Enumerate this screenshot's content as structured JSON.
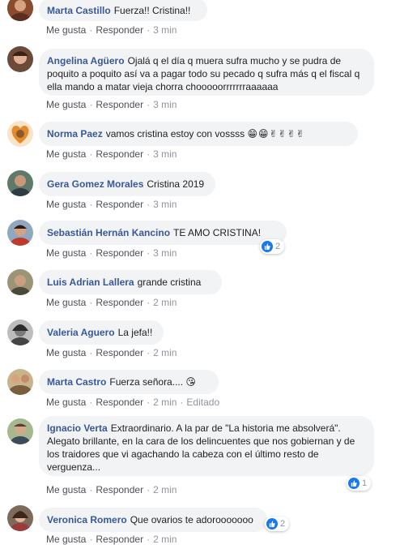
{
  "actions": {
    "like": "Me gusta",
    "reply": "Responder",
    "separator": "·"
  },
  "comments": [
    {
      "author": "Marta Castillo",
      "text": "Fuerza!! Cristina!!",
      "time": "3 min"
    },
    {
      "author": "Angelina Agüero",
      "text": "Ojalá q el día q muera sufra mucho y se pudra de poquito a poquito así va a pagar todo su pecado q sufra más q el fiscal q ella mando a matar vieja chorra chooooorrrrrrraaaaaa",
      "time": "3 min"
    },
    {
      "author": "Norma Paez",
      "text": "vamos cristina estoy con vossss",
      "emoji": "😁😁✌✌✌✌",
      "time": "3 min"
    },
    {
      "author": "Gera Gomez Morales",
      "text": "Cristina 2019",
      "time": "3 min"
    },
    {
      "author": "Sebastián Hernán Kancino",
      "text": "TE AMO CRISTINA!",
      "time": "3 min",
      "likes": "2"
    },
    {
      "author": "Luis Adrian Lallera",
      "text": "grande cristina",
      "time": "2 min"
    },
    {
      "author": "Valeria Aguero",
      "text": "La jefa!!",
      "time": "2 min"
    },
    {
      "author": "Marta Castro",
      "text": "Fuerza señora....",
      "emoji": "😘",
      "time": "2 min",
      "edited": "Editado"
    },
    {
      "author": "Ignacio Verta",
      "text": "Extraordinario. A la par de \"La historia me absolverá\". Alegato brillante, en la cara de los delincuentes que nos gobiernan y de los traidores que vi agachando la cabeza con el último resto de verguenza...",
      "time": "2 min",
      "likes": "1"
    },
    {
      "author": "Veronica Romero",
      "text": "Que ovarios te adorooooooo",
      "time": "2 min",
      "likes": "2"
    }
  ],
  "colors": {
    "author": "#385898",
    "bubble": "#f2f3f5",
    "like_blue": "#1877f2",
    "meta": "#90949c"
  }
}
